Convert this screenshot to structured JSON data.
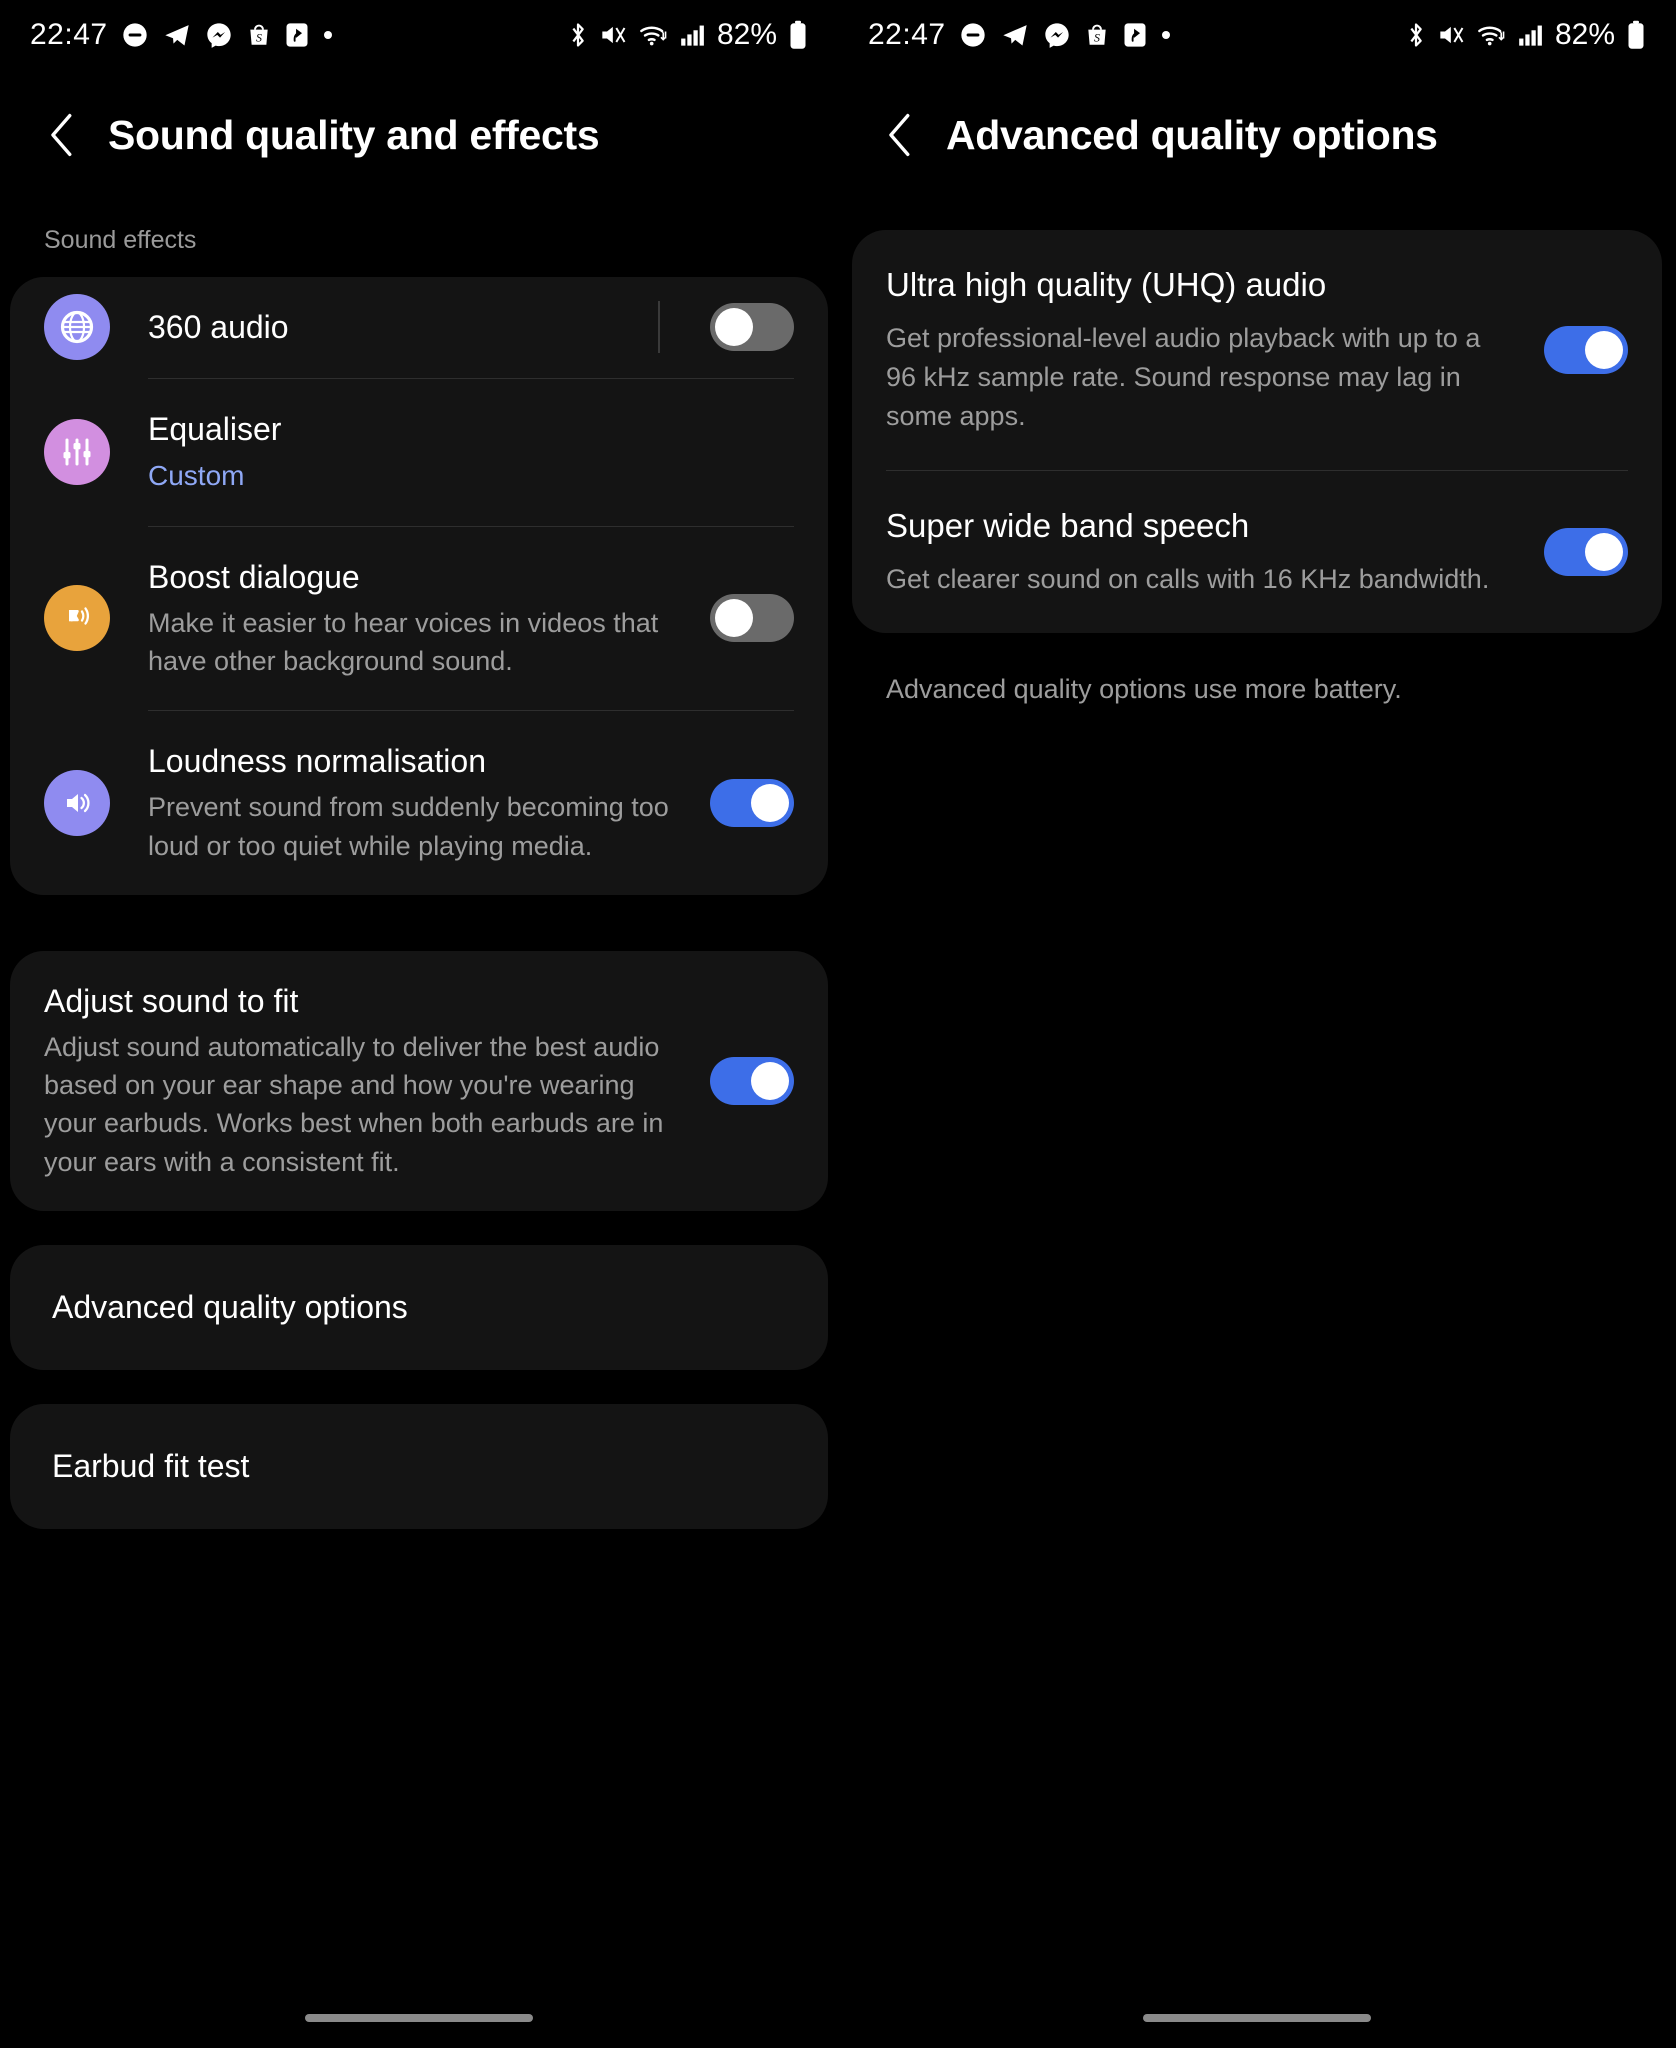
{
  "status_bar": {
    "time": "22:47",
    "battery_percent": "82%",
    "left_icons": [
      "dnd-icon",
      "telegram-icon",
      "messenger-icon",
      "shopee-icon",
      "app-icon",
      "dot-icon"
    ],
    "right_icons": [
      "bluetooth-icon",
      "mute-icon",
      "wifi-icon",
      "signal-icon",
      "battery-icon"
    ]
  },
  "left_screen": {
    "header": {
      "back_label": "back-arrow",
      "title": "Sound quality and effects"
    },
    "section_label": "Sound effects",
    "items": [
      {
        "id": "360-audio",
        "icon": "globe-360-icon",
        "title": "360 audio",
        "subtitle": "",
        "toggle": "off",
        "has_separator": true
      },
      {
        "id": "equaliser",
        "icon": "equaliser-sliders-icon",
        "title": "Equaliser",
        "subtitle": "Custom",
        "toggle": null,
        "has_separator": false
      },
      {
        "id": "boost-dialogue",
        "icon": "speaking-head-icon",
        "title": "Boost dialogue",
        "subtitle": "Make it easier to hear voices in videos that have other background sound.",
        "toggle": "off",
        "has_separator": false
      },
      {
        "id": "loudness-normalisation",
        "icon": "volume-speaker-icon",
        "title": "Loudness normalisation",
        "subtitle": "Prevent sound from suddenly becoming too loud or too quiet while playing media.",
        "toggle": "on",
        "has_separator": false
      }
    ],
    "adjust_sound": {
      "title": "Adjust sound to fit",
      "subtitle": "Adjust sound automatically to deliver the best audio based on your ear shape and how you're wearing your earbuds. Works best when both earbuds are in your ears with a consistent fit.",
      "toggle": "on"
    },
    "nav_items": [
      {
        "id": "advanced-quality-options",
        "label": "Advanced quality options"
      },
      {
        "id": "earbud-fit-test",
        "label": "Earbud fit test"
      }
    ]
  },
  "right_screen": {
    "header": {
      "back_label": "back-arrow",
      "title": "Advanced quality options"
    },
    "items": [
      {
        "id": "uhq-audio",
        "title": "Ultra high quality (UHQ) audio",
        "subtitle": "Get professional-level audio playback with up to a 96 kHz sample rate. Sound response may lag in some apps.",
        "toggle": "on"
      },
      {
        "id": "super-wide-band-speech",
        "title": "Super wide band speech",
        "subtitle": "Get clearer sound on calls with 16 KHz bandwidth.",
        "toggle": "on"
      }
    ],
    "footnote": "Advanced quality options use more battery."
  },
  "colors": {
    "background": "#000000",
    "card": "#141414",
    "toggle_on": "#3d6ee8",
    "toggle_off": "#6a6a6a",
    "accent_text": "#8fa8f5",
    "secondary_text": "#9d9d9d",
    "icon_360": "#8f8bf0",
    "icon_equaliser": "#d28fe0",
    "icon_boost": "#e8a33c",
    "icon_loudness": "#8f8bf0"
  }
}
